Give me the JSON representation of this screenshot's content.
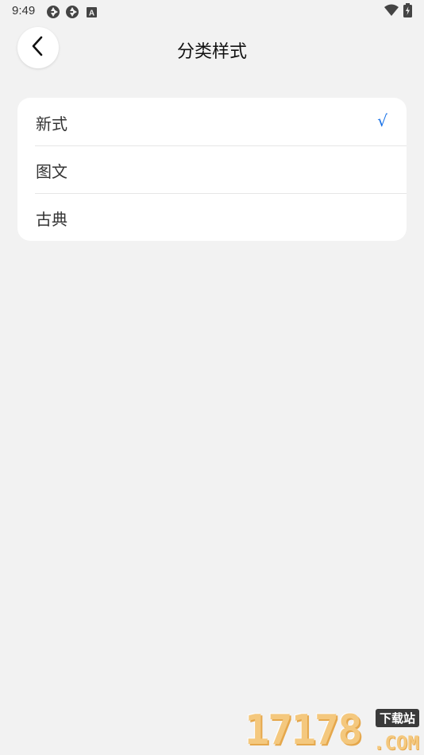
{
  "status_bar": {
    "time": "9:49",
    "left_icons": [
      "camera-aperture-icon",
      "camera-aperture-icon",
      "keyboard-a-icon"
    ],
    "right_icons": [
      "wifi-icon",
      "battery-charging-icon"
    ]
  },
  "nav": {
    "back_icon": "chevron-left-icon",
    "title": "分类样式"
  },
  "options": [
    {
      "label": "新式",
      "selected": true
    },
    {
      "label": "图文",
      "selected": false
    },
    {
      "label": "古典",
      "selected": false
    }
  ],
  "check_mark": "√",
  "colors": {
    "background": "#f2f2f2",
    "card": "#ffffff",
    "accent": "#1a73e8"
  },
  "watermark": {
    "digits": "17178",
    "badge": "下载站",
    "domain": ".COM"
  }
}
